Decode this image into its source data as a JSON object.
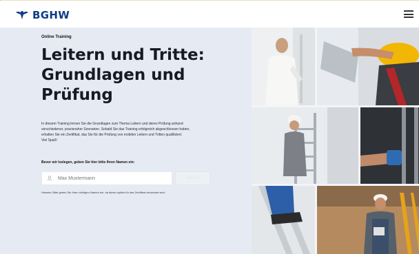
{
  "brand": {
    "name": "BGHW"
  },
  "header": {
    "menu_icon": "hamburger-icon"
  },
  "hero": {
    "eyebrow": "Online Training",
    "headline": "Leitern und Tritte: Grundlagen und Prüfung",
    "intro": "In diesem Training lernen Sie die Grundlagen zum Thema Leitern und deren Prüfung anhand verschiedener, praxisnaher Szenarien. Sobald Sie das Training erfolgreich abgeschlossen haben, erhalten Sie ein Zertifikat, das Sie für die Prüfung von mobilen Leitern und Tritten qualifiziert.",
    "intro_closing": "Viel Spaß!",
    "name_prompt": "Bevor wir loslegen, geben Sie hier bitte Ihren Namen ein:",
    "name_placeholder": "Max Mustermann",
    "start_label": "Starten",
    "note": "Hinweis: Bitte geben Sie Ihren richtigen Namen ein, da dieser später für das Zertifikat verwendet wird."
  },
  "colors": {
    "brand_blue": "#0d3d86",
    "hero_bg": "#e6ebf3"
  }
}
